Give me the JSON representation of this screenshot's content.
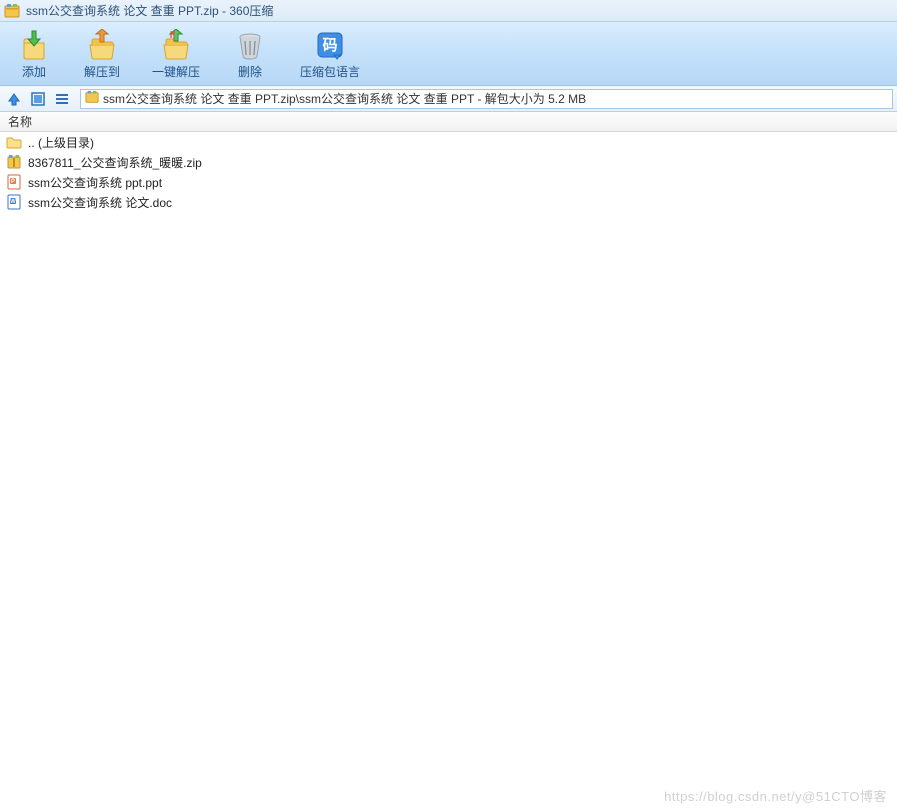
{
  "window": {
    "title": "ssm公交查询系统 论文 查重 PPT.zip - 360压缩"
  },
  "toolbar": {
    "add": "添加",
    "extract_to": "解压到",
    "one_click_extract": "一键解压",
    "delete": "删除",
    "archive_language": "压缩包语言"
  },
  "nav": {
    "path": "ssm公交查询系统 论文 查重 PPT.zip\\ssm公交查询系统 论文 查重 PPT - 解包大小为 5.2 MB"
  },
  "columns": {
    "name": "名称"
  },
  "files": [
    {
      "name": ".. (上级目录)",
      "type": "folder-up"
    },
    {
      "name": "8367811_公交查询系统_暖暖.zip",
      "type": "zip"
    },
    {
      "name": "ssm公交查询系统  ppt.ppt",
      "type": "ppt"
    },
    {
      "name": "ssm公交查询系统 论文.doc",
      "type": "doc"
    }
  ],
  "watermark": "https://blog.csdn.net/y@51CTO博客"
}
